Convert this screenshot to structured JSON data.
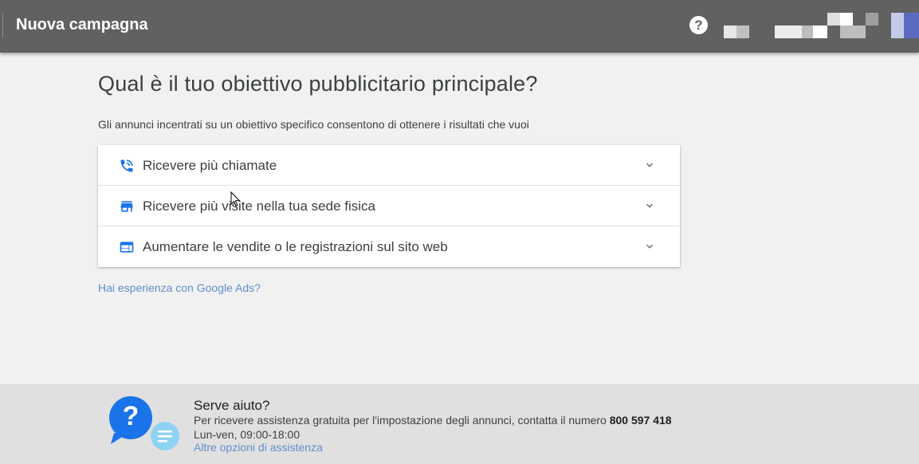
{
  "header": {
    "title": "Nuova campagna",
    "help_icon": "help-circle-icon",
    "help_glyph": "?"
  },
  "main": {
    "heading": "Qual è il tuo obiettivo pubblicitario principale?",
    "subtitle": "Gli annunci incentrati su un obiettivo specifico consentono di ottenere i risultati che vuoi",
    "options": [
      {
        "label": "Ricevere più chiamate",
        "icon": "phone-call-icon"
      },
      {
        "label": "Ricevere più visite nella tua sede fisica",
        "icon": "storefront-icon"
      },
      {
        "label": "Aumentare le vendite o le registrazioni sul sito web",
        "icon": "web-browser-icon"
      }
    ],
    "experience_link": "Hai esperienza con Google Ads?"
  },
  "footer": {
    "title": "Serve aiuto?",
    "line1_prefix": "Per ricevere assistenza gratuita per l'impostazione degli annunci, contatta il numero ",
    "phone": "800 597 418",
    "hours": "Lun-ven, 09:00-18:00",
    "more_link": "Altre opzioni di assistenza",
    "help_glyph": "?"
  },
  "colors": {
    "header_bg": "#616161",
    "accent_icon": "#1a73e8",
    "link": "#5f8fc9",
    "footer_bg": "#e0e0e0"
  }
}
